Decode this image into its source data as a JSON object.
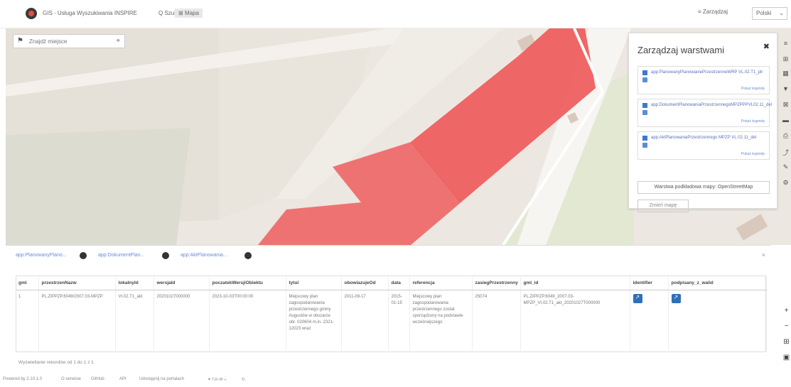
{
  "topbar": {
    "title": "GIS - Usługa Wyszukiwania INSPIRE",
    "nav": [
      {
        "label": "Q Szukaj",
        "active": false
      },
      {
        "label": "Mapa",
        "active": true
      }
    ],
    "manage_label": "Zarządzaj",
    "language": "Polski"
  },
  "search": {
    "placeholder": "Znajdź miejsce"
  },
  "layer_panel": {
    "title": "Zarządzaj warstwami",
    "layers": [
      {
        "name": "app:PlanowanyPlanowaniePrzestrzenneWRP VL.02.T1_plr",
        "legend": "Pokaż legendę"
      },
      {
        "name": "app:DokumentPlanowaniaPrzestrzennegoMPZPPPVL02.11_del",
        "legend": "Pokaż legendę"
      },
      {
        "name": "app:AktPlanowaniaPrzestrzennego MPZP VL.02.11_del",
        "legend": "Pokaż legendę"
      }
    ],
    "basemap_label": "Warstwa podkładowa mapy: OpenStreetMap",
    "clear_label": "Zmień mapę"
  },
  "attribute_panel": {
    "tabs": [
      {
        "label": "app:PlanowanyPlano..."
      },
      {
        "label": "app:DokumentPlan..."
      },
      {
        "label": "app:AktPlanowania..."
      }
    ],
    "columns": [
      "gml",
      "przestrzenNazw",
      "lokalnyId",
      "wersjaId",
      "poczatekWersjiObiektu",
      "tytul",
      "obowiazujeOd",
      "data",
      "referencja",
      "zasiegPrzestrzenny",
      "gml_id",
      "identifier",
      "podpisany_z_walid"
    ],
    "rows": [
      {
        "gml": "1",
        "przestrzenNazw": "PL.ZIPPZP.6049/2007.03-MPZP",
        "lokalnyId": "VI.02.T1_akt",
        "wersjaId": "20201027000000",
        "poczatekWersjiObiektu": "2023-10-03T00:00:00",
        "tytul": "Miejscowy plan zagospodarowania przestrzennego gminy Augustów w obszarze obr. 020604 m.in. 2321-12023 wraz",
        "obowiazujeOd": "2011-09-17",
        "data": "2015-01-15",
        "referencja": "Miejscowy plan zagospodarowania przestrzennego został sporządzony na podstawie wcześniejszego",
        "zasiegPrzestrzenny": "25074",
        "gml_id": "PL.ZIPPZP.6049_2007.03-MPZP_VI.02.T1_akt_20201027T000000"
      }
    ],
    "row_info": "Wyświetlanie rekordów od 1 do 1 z 1"
  },
  "footer": {
    "items": [
      "Powered by 2.10.1.0",
      "O serwisie",
      "GitHub",
      "API",
      "Udostępnij na portalach",
      "✦ f in ✉ ⤷",
      "↻"
    ]
  },
  "colors": {
    "plan_area": "#ef6b6b",
    "accent": "#3a7bd5"
  }
}
